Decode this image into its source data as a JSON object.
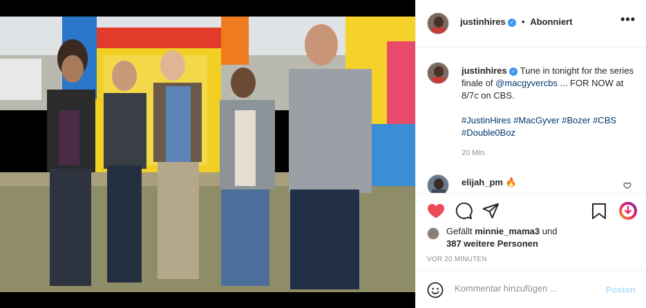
{
  "post": {
    "photo_alt": "Cast photo in front of bouncy castle"
  },
  "header": {
    "username": "justinhires",
    "separator": "•",
    "follow_status": "Abonniert",
    "more_icon": "more-options-icon"
  },
  "caption": {
    "username": "justinhires",
    "text_before_mention": "Tune in tonight for the series finale of",
    "mention": "@macgyvercbs",
    "text_after_mention": "... FOR NOW at 8/7c on CBS.",
    "hashtags": [
      "#JustinHires",
      "#MacGyver",
      "#Bozer",
      "#CBS",
      "#Double0Boz"
    ],
    "time": "20 Min."
  },
  "comment": {
    "username": "elijah_pm",
    "text": "🔥"
  },
  "likes": {
    "prefix": "Gefällt",
    "user": "minnie_mama3",
    "connector": "und",
    "others": "387 weitere Personen"
  },
  "timestamp": "VOR 20 MINUTEN",
  "comment_box": {
    "placeholder": "Kommentar hinzufügen ...",
    "post_label": "Posten"
  },
  "colors": {
    "like_red": "#ed4956",
    "link_blue": "#00376b",
    "verified_blue": "#3897f0",
    "post_disabled": "#b2dffc"
  }
}
